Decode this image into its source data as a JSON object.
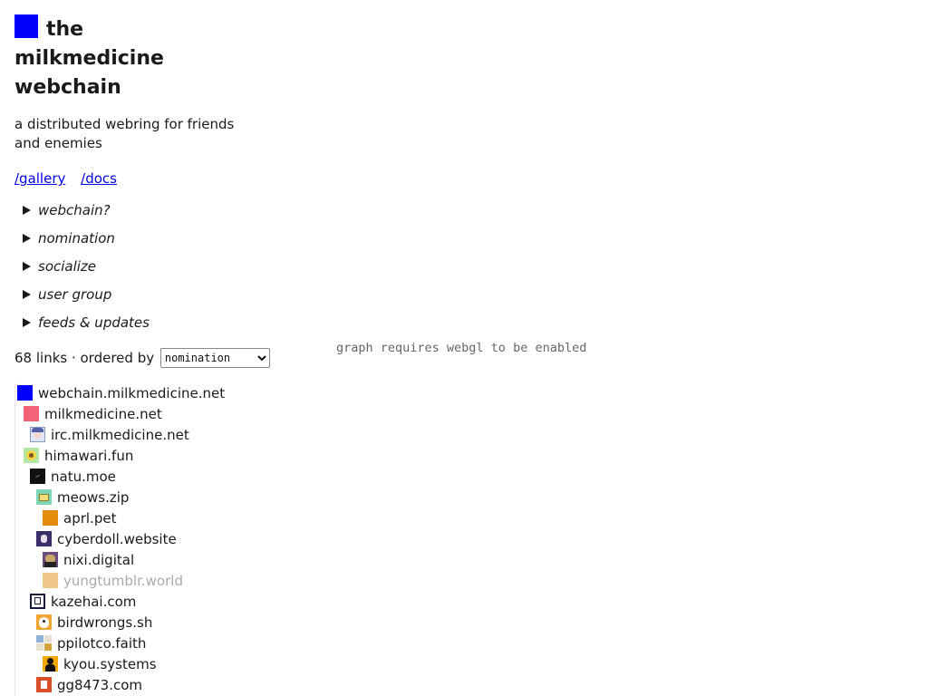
{
  "site": {
    "title_line1": "the",
    "title_line2": "milkmedicine",
    "title_line3": "webchain",
    "tagline": "a distributed webring for friends and enemies",
    "brand_color": "#0000ff"
  },
  "nav": {
    "gallery": "/gallery",
    "docs": "/docs"
  },
  "sections": [
    {
      "label": "webchain?"
    },
    {
      "label": "nomination"
    },
    {
      "label": "socialize"
    },
    {
      "label": "user group"
    },
    {
      "label": "feeds & updates"
    }
  ],
  "links_header": {
    "count_text": "68 links · ordered by",
    "order_selected": "nomination"
  },
  "tree": [
    {
      "label": "webchain.milkmedicine.net",
      "icon": "blue-square-icon",
      "depth": 0
    },
    {
      "label": "milkmedicine.net",
      "icon": "pink-square-icon",
      "depth": 1
    },
    {
      "label": "irc.milkmedicine.net",
      "icon": "anime-avatar-icon",
      "depth": 2
    },
    {
      "label": "himawari.fun",
      "icon": "sunflower-icon",
      "depth": 1
    },
    {
      "label": "natu.moe",
      "icon": "black-square-icon",
      "depth": 2
    },
    {
      "label": "meows.zip",
      "icon": "folder-icon",
      "depth": 3
    },
    {
      "label": "aprl.pet",
      "icon": "orange-square-icon",
      "depth": 4
    },
    {
      "label": "cyberdoll.website",
      "icon": "doll-avatar-icon",
      "depth": 3
    },
    {
      "label": "nixi.digital",
      "icon": "character-avatar-icon",
      "depth": 4
    },
    {
      "label": "yungtumblr.world",
      "icon": "tan-square-icon",
      "depth": 4,
      "dim": true
    },
    {
      "label": "kazehai.com",
      "icon": "kanji-icon",
      "depth": 2
    },
    {
      "label": "birdwrongs.sh",
      "icon": "bird-icon",
      "depth": 3
    },
    {
      "label": "ppilotco.faith",
      "icon": "checker-icon",
      "depth": 3
    },
    {
      "label": "kyou.systems",
      "icon": "silhouette-icon",
      "depth": 4
    },
    {
      "label": "gg8473.com",
      "icon": "badge-icon",
      "depth": 3
    }
  ],
  "graph": {
    "message": "graph requires webgl to be enabled"
  }
}
